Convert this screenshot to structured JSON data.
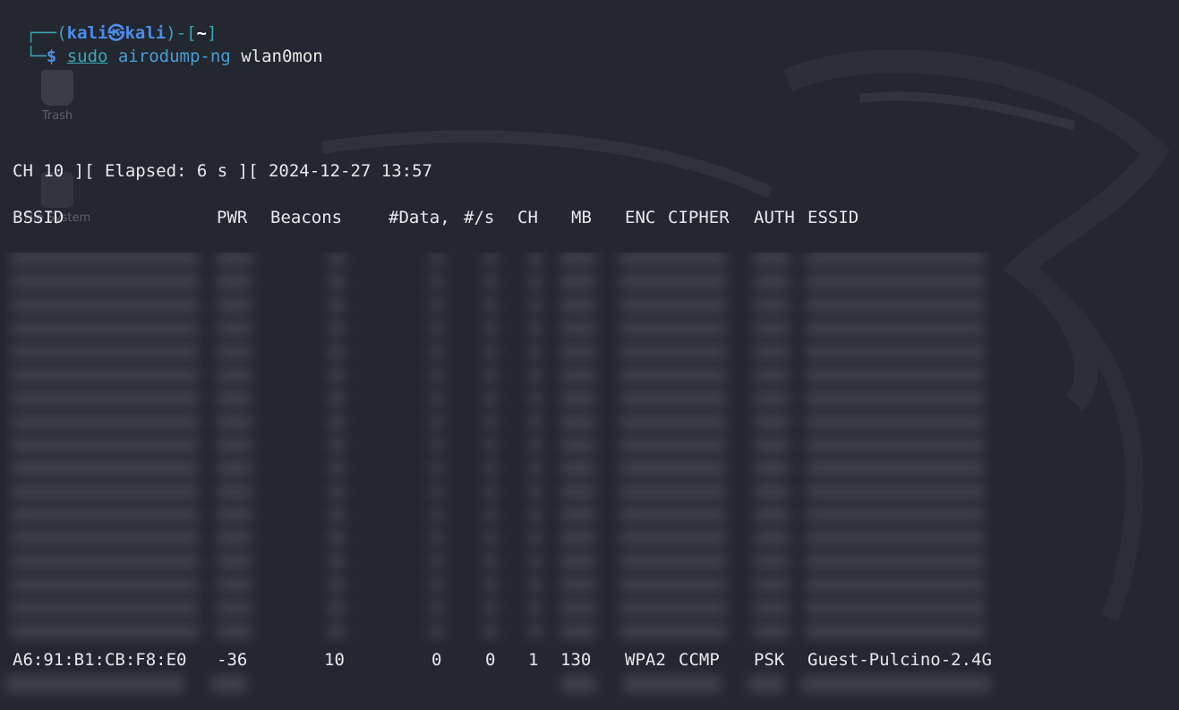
{
  "prompt": {
    "corner_top": "┌──(",
    "user": "kali",
    "separator": "㉿",
    "host": "kali",
    "close_bracket": ")-[",
    "path": "~",
    "end_bracket": "]",
    "corner_bottom": "└─",
    "dollar": "$",
    "command_sudo": "sudo",
    "command_main": "airodump-ng",
    "command_arg": "wlan0mon"
  },
  "desktop": {
    "icons": [
      {
        "label": "Trash",
        "icon": "trash-icon"
      },
      {
        "label": "File System",
        "icon": "drive-icon"
      }
    ]
  },
  "airodump": {
    "status_line": "CH 10 ][ Elapsed: 6 s ][ 2024-12-27 13:57",
    "columns": {
      "bssid": "BSSID",
      "pwr": "PWR",
      "beacons": "Beacons",
      "data": "#Data,",
      "per_s": "#/s",
      "ch": "CH",
      "mb": "MB",
      "enc": "ENC",
      "cipher": "CIPHER",
      "auth": "AUTH",
      "essid": "ESSID"
    },
    "visible_row": {
      "bssid": "A6:91:B1:CB:F8:E0",
      "pwr": "-36",
      "beacons": "10",
      "data": "0",
      "per_s": "0",
      "ch": "1",
      "mb": "130",
      "enc": "WPA2",
      "cipher": "CCMP",
      "auth": "PSK",
      "essid": "Guest-Pulcino-2.4G"
    },
    "blurred_rows_note": ""
  },
  "colors": {
    "background": "#232730",
    "prompt_teal": "#3aa6b5",
    "prompt_blue": "#4d8dea",
    "text": "#e6e8ec"
  }
}
